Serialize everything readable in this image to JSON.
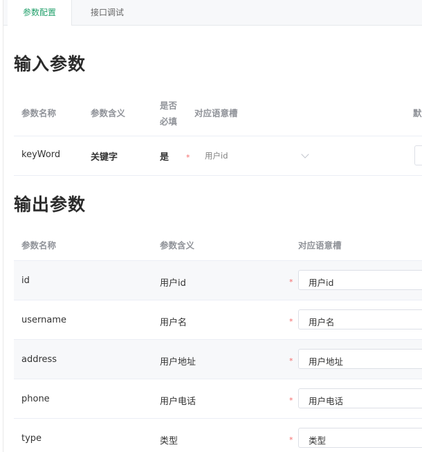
{
  "tabs": [
    {
      "label": "参数配置",
      "active": true
    },
    {
      "label": "接口调试",
      "active": false
    }
  ],
  "input_section": {
    "title": "输入参数",
    "headers": {
      "name": "参数名称",
      "meaning": "参数含义",
      "required_line1": "是否",
      "required_line2": "必填",
      "slot": "对应语意槽",
      "default_partial": "默"
    },
    "rows": [
      {
        "name": "keyWord",
        "meaning": "关键字",
        "required": "是",
        "required_mark": "*",
        "slot_value": "用户id"
      }
    ]
  },
  "output_section": {
    "title": "输出参数",
    "headers": {
      "name": "参数名称",
      "meaning": "参数含义",
      "slot": "对应语意槽"
    },
    "rows": [
      {
        "name": "id",
        "meaning": "用户id",
        "required_mark": "*",
        "slot_value": "用户id"
      },
      {
        "name": "username",
        "meaning": "用户名",
        "required_mark": "*",
        "slot_value": "用户名"
      },
      {
        "name": "address",
        "meaning": "用户地址",
        "required_mark": "*",
        "slot_value": "用户地址"
      },
      {
        "name": "phone",
        "meaning": "用户电话",
        "required_mark": "*",
        "slot_value": "用户电话"
      },
      {
        "name": "type",
        "meaning": "类型",
        "required_mark": "*",
        "slot_value": "类型"
      }
    ]
  },
  "colors": {
    "accent": "#22a06b",
    "required": "#f56c6c",
    "header_text": "#909399",
    "row_alt_bg": "#f7f8fa"
  },
  "icons": {
    "select_arrow": "chevron-down-icon"
  }
}
